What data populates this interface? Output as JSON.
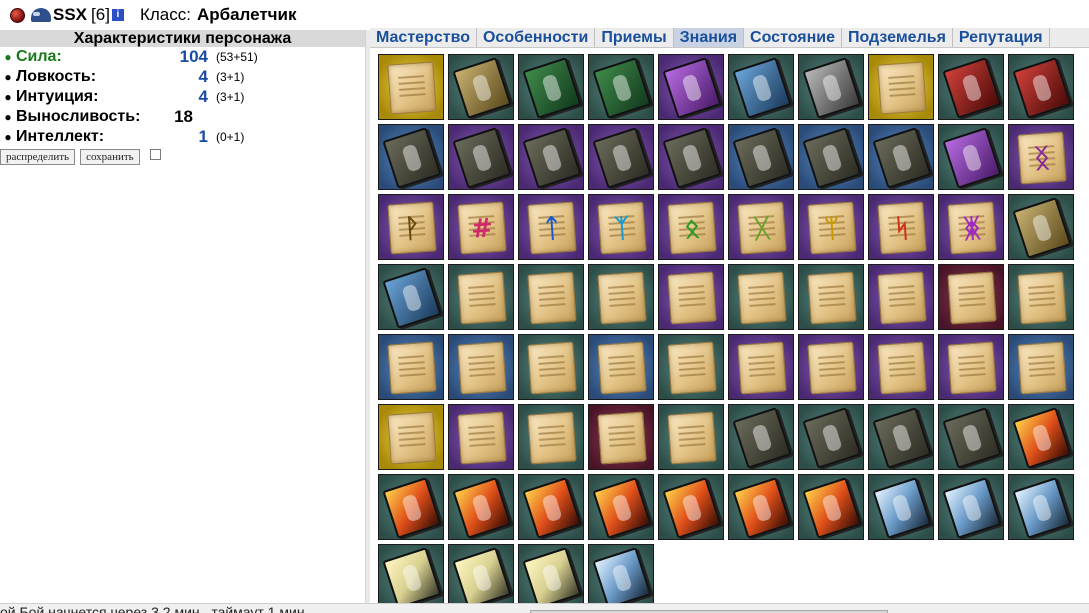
{
  "header": {
    "nick": "SSX",
    "level": "[6]",
    "info_glyph": "i",
    "class_label": "Класс:",
    "class_value": "Арбалетчик"
  },
  "stats": {
    "title": "Характеристики персонажа",
    "items": [
      {
        "label": "Сила:",
        "value": "104",
        "extra": "(53+51)"
      },
      {
        "label": "Ловкость:",
        "value": "4",
        "extra": "(3+1)"
      },
      {
        "label": "Интуиция:",
        "value": "4",
        "extra": "(3+1)"
      },
      {
        "label": "Выносливость:",
        "value": "18",
        "extra": ""
      },
      {
        "label": "Интеллект:",
        "value": "1",
        "extra": "(0+1)"
      }
    ],
    "distribute_label": "распределить",
    "save_label": "сохранить"
  },
  "tabs": [
    {
      "label": "Мастерство",
      "active": false
    },
    {
      "label": "Особенности",
      "active": false
    },
    {
      "label": "Приемы",
      "active": false
    },
    {
      "label": "Знания",
      "active": true
    },
    {
      "label": "Состояние",
      "active": false
    },
    {
      "label": "Подземелья",
      "active": false
    },
    {
      "label": "Репутация",
      "active": false
    }
  ],
  "colors": {
    "link_blue": "#1a4f9c",
    "strength_green": "#1a7a1a",
    "stat_value_blue": "#1a4aa8",
    "active_tab": "#c8d2e3"
  },
  "grid": [
    {
      "bg": "yellow",
      "kind": "scroll"
    },
    {
      "bg": "green",
      "kind": "book-gold"
    },
    {
      "bg": "green",
      "kind": "book-green"
    },
    {
      "bg": "green",
      "kind": "book-green"
    },
    {
      "bg": "purple",
      "kind": "book-purple"
    },
    {
      "bg": "green",
      "kind": "book-blue"
    },
    {
      "bg": "green",
      "kind": "book-grey"
    },
    {
      "bg": "yellow",
      "kind": "scroll"
    },
    {
      "bg": "green",
      "kind": "book-red"
    },
    {
      "bg": "green",
      "kind": "book-red"
    },
    {
      "bg": "blue",
      "kind": "book-dark"
    },
    {
      "bg": "purple",
      "kind": "book-dark"
    },
    {
      "bg": "purple",
      "kind": "book-dark"
    },
    {
      "bg": "purple",
      "kind": "book-dark"
    },
    {
      "bg": "purple",
      "kind": "book-dark"
    },
    {
      "bg": "blue",
      "kind": "book-dark"
    },
    {
      "bg": "blue",
      "kind": "book-dark"
    },
    {
      "bg": "blue",
      "kind": "book-dark"
    },
    {
      "bg": "green",
      "kind": "book-purple"
    },
    {
      "bg": "purple",
      "kind": "rune",
      "glyph": "ᛝ",
      "color": "#8a2a9a"
    },
    {
      "bg": "purple",
      "kind": "rune",
      "glyph": "ᚹ",
      "color": "#6a4a10"
    },
    {
      "bg": "purple",
      "kind": "rune",
      "glyph": "#",
      "color": "#d02a6a"
    },
    {
      "bg": "purple",
      "kind": "rune",
      "glyph": "ᛏ",
      "color": "#1a5ad0"
    },
    {
      "bg": "purple",
      "kind": "rune",
      "glyph": "ᛉ",
      "color": "#1a9ad0"
    },
    {
      "bg": "purple",
      "kind": "rune",
      "glyph": "ᛟ",
      "color": "#2a9a2a"
    },
    {
      "bg": "purple",
      "kind": "rune",
      "glyph": "ᚷ",
      "color": "#6aa02a"
    },
    {
      "bg": "purple",
      "kind": "rune",
      "glyph": "ᛘ",
      "color": "#c89a0a"
    },
    {
      "bg": "purple",
      "kind": "rune",
      "glyph": "ᛋ",
      "color": "#d0301a"
    },
    {
      "bg": "purple",
      "kind": "rune",
      "glyph": "ᛤ",
      "color": "#a02ac0"
    },
    {
      "bg": "green",
      "kind": "book-gold"
    },
    {
      "bg": "green",
      "kind": "book-blue"
    },
    {
      "bg": "green",
      "kind": "scroll"
    },
    {
      "bg": "green",
      "kind": "scroll"
    },
    {
      "bg": "green",
      "kind": "scroll"
    },
    {
      "bg": "purple",
      "kind": "scroll"
    },
    {
      "bg": "green",
      "kind": "scroll"
    },
    {
      "bg": "green",
      "kind": "scroll"
    },
    {
      "bg": "purple",
      "kind": "scroll"
    },
    {
      "bg": "red",
      "kind": "scroll"
    },
    {
      "bg": "green",
      "kind": "scroll"
    },
    {
      "bg": "blue",
      "kind": "scroll"
    },
    {
      "bg": "blue",
      "kind": "scroll"
    },
    {
      "bg": "green",
      "kind": "scroll"
    },
    {
      "bg": "blue",
      "kind": "scroll"
    },
    {
      "bg": "green",
      "kind": "scroll"
    },
    {
      "bg": "purple",
      "kind": "scroll"
    },
    {
      "bg": "purple",
      "kind": "scroll"
    },
    {
      "bg": "purple",
      "kind": "scroll"
    },
    {
      "bg": "purple",
      "kind": "scroll"
    },
    {
      "bg": "blue",
      "kind": "scroll"
    },
    {
      "bg": "yellow",
      "kind": "scroll"
    },
    {
      "bg": "purple",
      "kind": "scroll"
    },
    {
      "bg": "green",
      "kind": "scroll"
    },
    {
      "bg": "red",
      "kind": "scroll"
    },
    {
      "bg": "green",
      "kind": "scroll"
    },
    {
      "bg": "green",
      "kind": "book-dark"
    },
    {
      "bg": "green",
      "kind": "book-dark"
    },
    {
      "bg": "green",
      "kind": "book-dark"
    },
    {
      "bg": "green",
      "kind": "book-dark"
    },
    {
      "bg": "green",
      "kind": "book-fire"
    },
    {
      "bg": "green",
      "kind": "book-fire"
    },
    {
      "bg": "green",
      "kind": "book-fire"
    },
    {
      "bg": "green",
      "kind": "book-fire"
    },
    {
      "bg": "green",
      "kind": "book-fire"
    },
    {
      "bg": "green",
      "kind": "book-fire"
    },
    {
      "bg": "green",
      "kind": "book-fire"
    },
    {
      "bg": "green",
      "kind": "book-fire"
    },
    {
      "bg": "green",
      "kind": "book-ice"
    },
    {
      "bg": "green",
      "kind": "book-ice"
    },
    {
      "bg": "green",
      "kind": "book-ice"
    },
    {
      "bg": "green",
      "kind": "book-light"
    },
    {
      "bg": "green",
      "kind": "book-light"
    },
    {
      "bg": "green",
      "kind": "book-light"
    },
    {
      "bg": "green",
      "kind": "book-ice"
    }
  ],
  "footer": {
    "status_text": "ой Бой начнется через 3.2 мин., таймаут 1 мин."
  }
}
